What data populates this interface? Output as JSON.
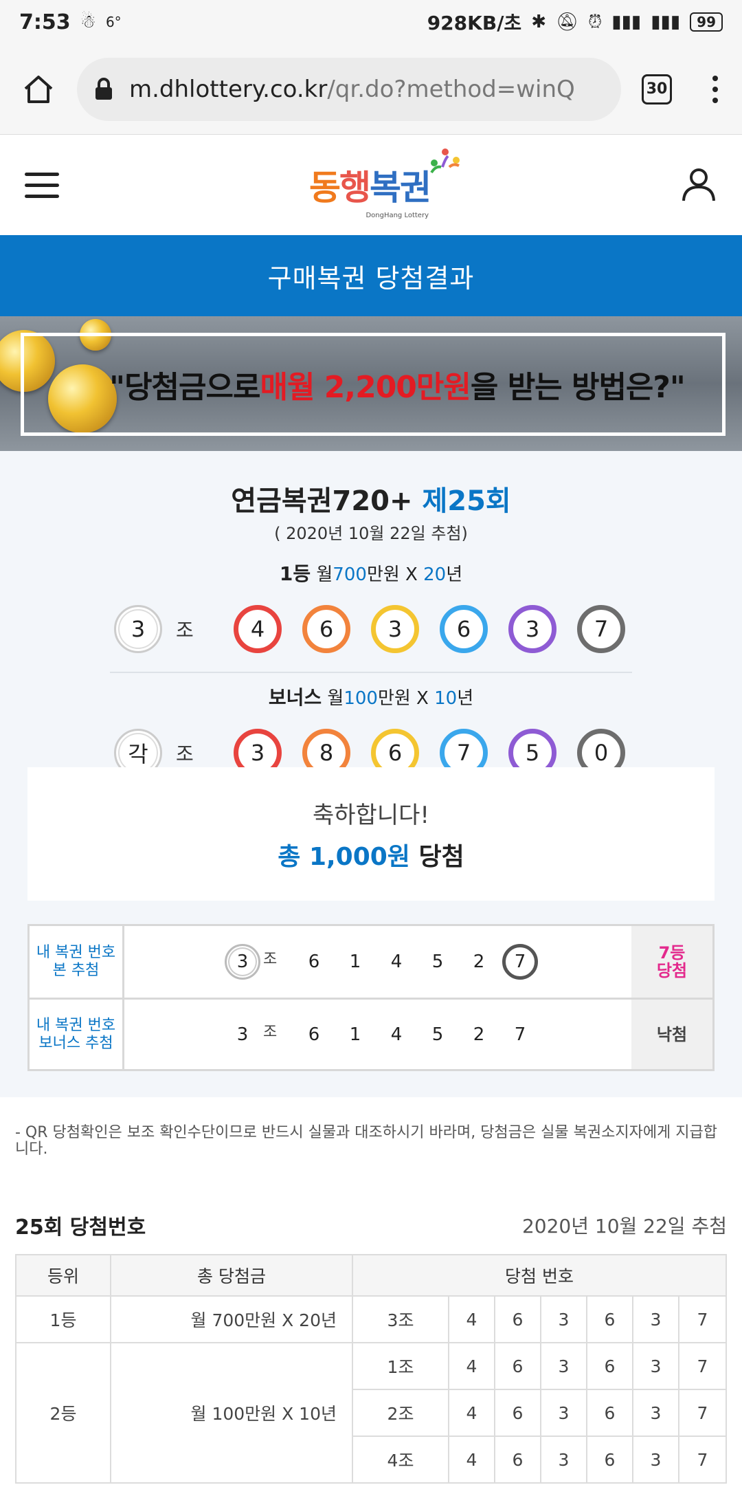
{
  "status": {
    "time": "7:53",
    "temp": "6°",
    "speed": "928KB/초",
    "battery": "99"
  },
  "browser": {
    "url_host": "m.dhlottery.co.kr",
    "url_path": "/qr.do?method=winQ",
    "tab_count": "30"
  },
  "logo": {
    "part1": "동",
    "part2": "행",
    "part3": "복권",
    "sub": "DongHang Lottery"
  },
  "page_title": "구매복권 당첨결과",
  "banner": {
    "pre": "\"당첨금으로 ",
    "highlight": "매월 2,200만원",
    "post": "을 받는 방법은?\""
  },
  "game": {
    "name": "연금복권720+ ",
    "round": "제25회",
    "draw_date": "( 2020년 10월 22일 추첨)"
  },
  "first_prize": {
    "rank": "1등",
    "t1": " 월",
    "amount": "700",
    "t2": "만원 X ",
    "years": "20",
    "t3": "년",
    "group": "3",
    "group_suffix": "조",
    "numbers": [
      "4",
      "6",
      "3",
      "6",
      "3",
      "7"
    ]
  },
  "bonus_prize": {
    "rank": "보너스",
    "t1": " 월",
    "amount": "100",
    "t2": "만원 X ",
    "years": "10",
    "t3": "년",
    "group": "각",
    "group_suffix": "조",
    "numbers": [
      "3",
      "8",
      "6",
      "7",
      "5",
      "0"
    ]
  },
  "congrats": {
    "line1": "축하합니다!",
    "total_label": "총 ",
    "total": "1,000원",
    "won": " 당첨"
  },
  "my_tickets": [
    {
      "label1": "내 복권 번호",
      "label2": "본 추첨",
      "group": "3",
      "jo": "조",
      "digits": [
        "6",
        "1",
        "4",
        "5",
        "2",
        "7"
      ],
      "result1": "7등",
      "result2": "당첨"
    },
    {
      "label1": "내 복권 번호",
      "label2": "보너스 추첨",
      "group": "3",
      "jo": "조",
      "digits": [
        "6",
        "1",
        "4",
        "5",
        "2",
        "7"
      ],
      "result1": "낙첨",
      "result2": ""
    }
  ],
  "notice": "- QR 당첨확인은 보조 확인수단이므로 반드시 실물과 대조하시기 바라며, 당첨금은 실물 복권소지자에게 지급합니다.",
  "win_table": {
    "title": "25회 당첨번호",
    "date": "2020년 10월 22일 추첨",
    "headers": [
      "등위",
      "총 당첨금",
      "당첨 번호"
    ],
    "rows": [
      {
        "rank": "1등",
        "amount": "월 700만원 X 20년",
        "group": "3조",
        "nums": [
          "4",
          "6",
          "3",
          "6",
          "3",
          "7"
        ]
      },
      {
        "rank": "2등",
        "amount": "월 100만원 X 10년",
        "group": "1조",
        "nums": [
          "4",
          "6",
          "3",
          "6",
          "3",
          "7"
        ]
      },
      {
        "group": "2조",
        "nums": [
          "4",
          "6",
          "3",
          "6",
          "3",
          "7"
        ]
      },
      {
        "group": "4조",
        "nums": [
          "4",
          "6",
          "3",
          "6",
          "3",
          "7"
        ]
      }
    ]
  }
}
